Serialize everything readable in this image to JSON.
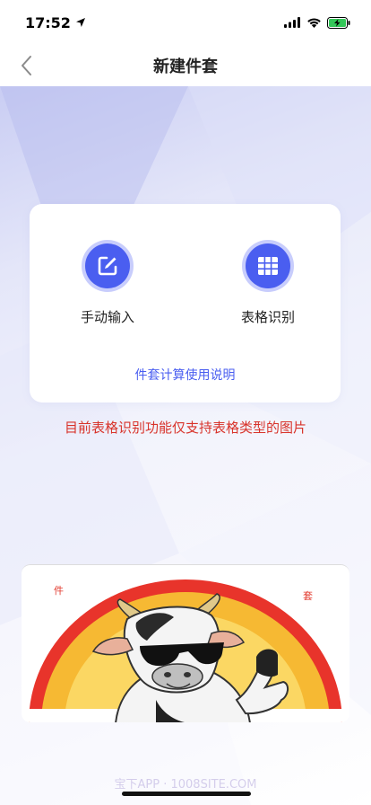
{
  "status": {
    "time": "17:52"
  },
  "nav": {
    "title": "新建件套"
  },
  "card": {
    "manual_label": "手动输入",
    "table_label": "表格识别",
    "help_link": "件套计算使用说明"
  },
  "notice": "目前表格识别功能仅支持表格类型的图片",
  "banner": {
    "left_text": "件",
    "right_text": "套"
  },
  "watermark": "宝下APP · 1008SITE.COM",
  "colors": {
    "accent": "#4a5ef0",
    "notice": "#d8332a"
  }
}
